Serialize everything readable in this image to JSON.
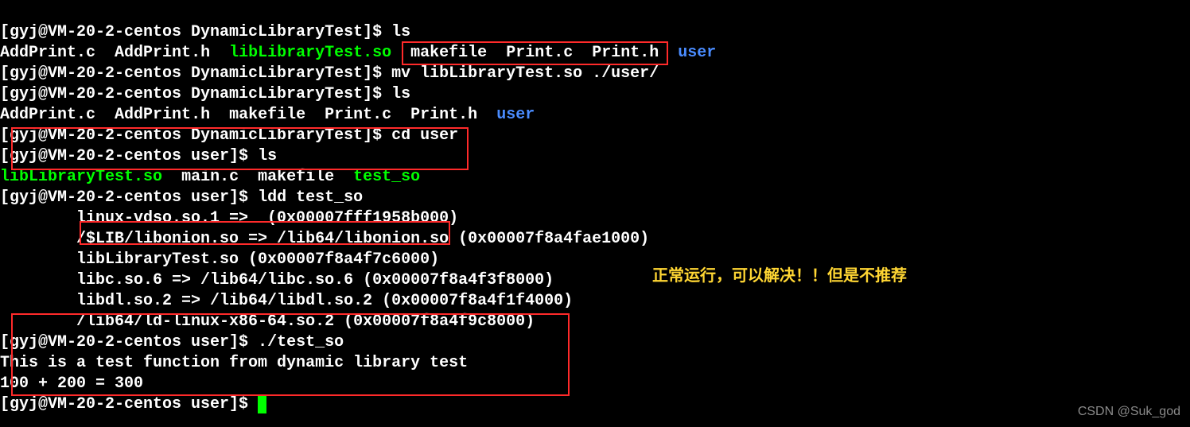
{
  "prompt1": "[gyj@VM-20-2-centos DynamicLibraryTest]$ ",
  "prompt_user": "[gyj@VM-20-2-centos user]$ ",
  "cmd_ls": "ls",
  "cmd_mv": "mv libLibraryTest.so ./user/",
  "cmd_cd": "cd user",
  "cmd_ldd": "ldd test_so",
  "cmd_run": "./test_so",
  "ls1": {
    "f1": "AddPrint.c",
    "f2": "AddPrint.h",
    "f3": "libLibraryTest.so",
    "f4": "makefile",
    "f5": "Print.c",
    "f6": "Print.h",
    "f7": "user"
  },
  "ls2": {
    "f1": "AddPrint.c",
    "f2": "AddPrint.h",
    "f3": "makefile",
    "f4": "Print.c",
    "f5": "Print.h",
    "f6": "user"
  },
  "ls3": {
    "f1": "libLibraryTest.so",
    "f2": "main.c",
    "f3": "makefile",
    "f4": "test_so"
  },
  "ldd": {
    "l1": "        linux-vdso.so.1 =>  (0x00007fff1958b000)",
    "l2": "        /$LIB/libonion.so => /lib64/libonion.so (0x00007f8a4fae1000)",
    "l3": "        libLibraryTest.so (0x00007f8a4f7c6000)",
    "l4": "        libc.so.6 => /lib64/libc.so.6 (0x00007f8a4f3f8000)",
    "l5": "        libdl.so.2 => /lib64/libdl.so.2 (0x00007f8a4f1f4000)",
    "l6": "        /lib64/ld-linux-x86-64.so.2 (0x00007f8a4f9c8000)"
  },
  "out": {
    "l1": "This is a test function from dynamic library test",
    "l2": "100 + 200 = 300"
  },
  "note": "正常运行，可以解决！！但是不推荐",
  "watermark": "CSDN @Suk_god"
}
